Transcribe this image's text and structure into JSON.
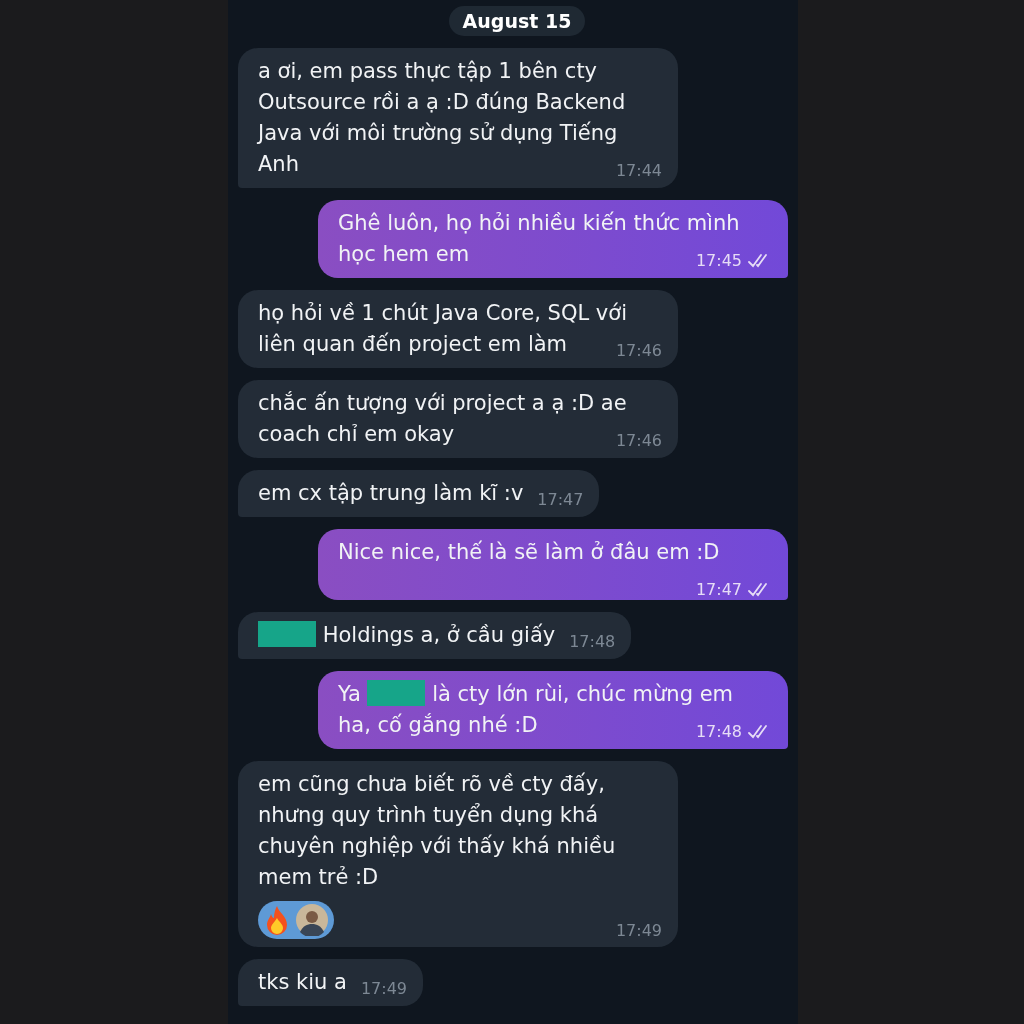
{
  "date_label": "August 15",
  "messages": [
    {
      "kind": "incoming",
      "parts": [
        {
          "kind": "text",
          "text": "a ơi, em pass thực tập 1 bên cty Outsource rồi a ạ :D đúng Backend Java với môi trường sử dụng Tiếng Anh"
        }
      ],
      "time": "17:44",
      "tail": true
    },
    {
      "kind": "outgoing",
      "parts": [
        {
          "kind": "text",
          "text": "Ghê luôn, họ hỏi nhiều kiến thức mình học hem em"
        }
      ],
      "time": "17:45",
      "read": true,
      "tail": true
    },
    {
      "kind": "incoming",
      "parts": [
        {
          "kind": "text",
          "text": "họ hỏi về 1 chút Java Core, SQL với liên quan đến project em làm"
        }
      ],
      "time": "17:46",
      "tail": false
    },
    {
      "kind": "incoming",
      "parts": [
        {
          "kind": "text",
          "text": "chắc ấn tượng với project a ạ :D ae coach chỉ em okay"
        }
      ],
      "time": "17:46",
      "tail": false
    },
    {
      "kind": "incoming",
      "parts": [
        {
          "kind": "text",
          "text": "em cx tập trung làm kĩ :v"
        }
      ],
      "time": "17:47",
      "tail": true
    },
    {
      "kind": "outgoing",
      "parts": [
        {
          "kind": "text",
          "text": "Nice nice, thế là sẽ làm ở đâu em :D"
        }
      ],
      "time": "17:47",
      "read": true,
      "tail": true
    },
    {
      "kind": "incoming",
      "parts": [
        {
          "kind": "redaction"
        },
        {
          "kind": "text",
          "text": " Holdings a, ở cầu giấy"
        }
      ],
      "time": "17:48",
      "tail": true
    },
    {
      "kind": "outgoing",
      "parts": [
        {
          "kind": "text",
          "text": "Ya "
        },
        {
          "kind": "redaction"
        },
        {
          "kind": "text",
          "text": " là cty lớn rùi, chúc mừng em ha, cố gắng nhé :D"
        }
      ],
      "time": "17:48",
      "read": true,
      "tail": true
    },
    {
      "kind": "incoming",
      "parts": [
        {
          "kind": "text",
          "text": "em cũng chưa biết rõ về cty đấy, nhưng quy trình tuyển dụng khá chuyên nghiệp với thấy khá nhiều mem trẻ :D"
        }
      ],
      "time": "17:49",
      "reactions": [
        {
          "kind": "fire"
        },
        {
          "kind": "avatar"
        }
      ],
      "tail": false
    },
    {
      "kind": "incoming",
      "parts": [
        {
          "kind": "text",
          "text": "tks kiu a"
        }
      ],
      "time": "17:49",
      "tail": true
    }
  ]
}
